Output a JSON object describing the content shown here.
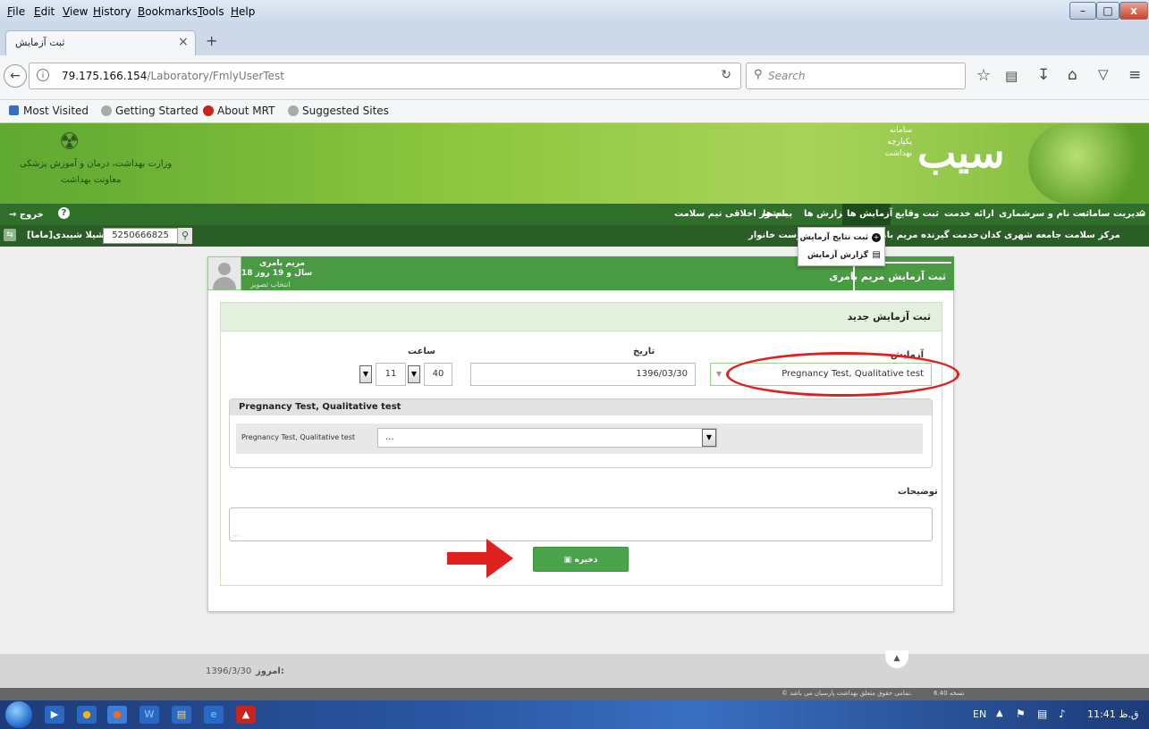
{
  "menubar": {
    "items": [
      "File",
      "Edit",
      "View",
      "History",
      "Bookmarks",
      "Tools",
      "Help"
    ],
    "window_controls": {
      "minimize": "–",
      "maximize": "□",
      "close": "x"
    }
  },
  "browser": {
    "tab_title": "ثبت آزمایش",
    "tab_close": "×",
    "new_tab": "+",
    "url_host": "79.175.166.154",
    "url_path": "/Laboratory/FmlyUserTest",
    "search_placeholder": "Search",
    "bookmarks": [
      "Most Visited",
      "Getting Started",
      "About MRT",
      "Suggested Sites"
    ]
  },
  "header": {
    "ministry_line1": "وزارت بهداشت، درمان و آموزش پزشکی",
    "ministry_line2": "معاونت بهداشت",
    "brand": "سیب",
    "brand_sub": [
      "سامانه",
      "یکپارچه",
      "بهداشت"
    ]
  },
  "mainnav": {
    "items": [
      "مدیریت سامانه",
      "ثبت نام و سرشماری",
      "ارائه خدمت",
      "ثبت وقایع",
      "آزمایش ها",
      "گزارش ها",
      "پیام ها",
      "منشور اخلاقی تیم سلامت"
    ],
    "exit": "خروج"
  },
  "subnav": {
    "center": "مرکز سلامت جامعه شهری کدان",
    "service_receiver": "خدمت گیرنده مریم بامری",
    "family_list": "فهرست خانوار",
    "search_value": "5250666825",
    "user": "شیلا شیبدی[ماما]"
  },
  "dropdown": {
    "items": [
      "ثبت نتایج آزمایش",
      "گزارش آزمایش"
    ]
  },
  "patient": {
    "name": "مریم بامری",
    "age": "18 سال و 19 روز",
    "choose_photo": "انتخاب تصویر"
  },
  "form": {
    "card_title": "ثبت آزمایش مریم بامری",
    "section_title": "ثبت آزمایش جدید",
    "label_test": "آزمایش",
    "label_date": "تاریخ",
    "label_time": "ساعت",
    "test_value": "Pregnancy Test, Qualitative test",
    "date_value": "1396/03/30",
    "hour": "11",
    "minute": "40",
    "result_panel_title": "Pregnancy Test, Qualitative test",
    "result_label": "Pregnancy Test, Qualitative test",
    "result_value": "...",
    "notes_label": "توضیحات",
    "save_label": "ذخیره"
  },
  "footer": {
    "today": "1396/3/30",
    "today_label": "امروز:",
    "version": "نسخه 6.40",
    "copyright": "© تمامی حقوق متعلق بهداشت پارسیان می باشد."
  },
  "taskbar": {
    "lang": "EN",
    "clock": "11:41 ق.ظ"
  }
}
